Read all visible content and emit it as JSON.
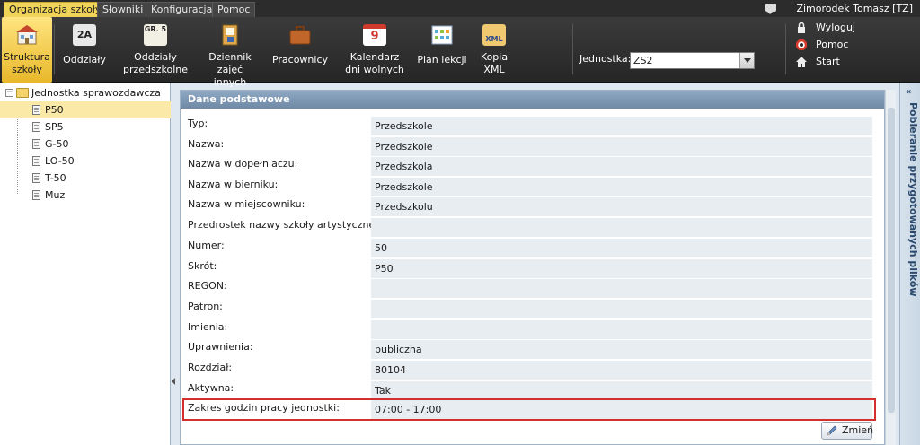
{
  "tabs": [
    "Organizacja szkoły",
    "Słowniki",
    "Konfiguracja",
    "Pomoc"
  ],
  "user": "Zimorodek Tomasz [TZ]",
  "toolbar": {
    "items": [
      {
        "label": "Struktura szkoły",
        "icon": "school-structure-icon"
      },
      {
        "label": "Oddziały",
        "icon": "class-2a-icon",
        "badge": "2A"
      },
      {
        "label": "Oddziały przedszkolne",
        "icon": "preschool-class-icon",
        "badge": "GR. 5"
      },
      {
        "label": "Dziennik zajęć innych",
        "icon": "journal-icon"
      },
      {
        "label": "Pracownicy",
        "icon": "briefcase-icon"
      },
      {
        "label": "Kalendarz dni wolnych",
        "icon": "calendar-icon",
        "badge": "9"
      },
      {
        "label": "Plan lekcji",
        "icon": "timetable-icon"
      },
      {
        "label": "Kopia XML",
        "icon": "xml-icon",
        "badge": "XML"
      }
    ],
    "unit_label": "Jednostka:",
    "unit_value": "ZS2",
    "links": [
      "Wyloguj",
      "Pomoc",
      "Start"
    ]
  },
  "tree": {
    "root": "Jednostka sprawozdawcza",
    "items": [
      "P50",
      "SP5",
      "G-50",
      "LO-50",
      "T-50",
      "Muz"
    ],
    "selected": "P50"
  },
  "panel": {
    "title": "Dane podstawowe",
    "fields": [
      {
        "label": "Typ:",
        "value": "Przedszkole"
      },
      {
        "label": "Nazwa:",
        "value": "Przedszkole"
      },
      {
        "label": "Nazwa w dopełniaczu:",
        "value": "Przedszkola"
      },
      {
        "label": "Nazwa w bierniku:",
        "value": "Przedszkole"
      },
      {
        "label": "Nazwa w miejscowniku:",
        "value": "Przedszkolu"
      },
      {
        "label": "Przedrostek nazwy szkoły artystycznej:",
        "value": ""
      },
      {
        "label": "Numer:",
        "value": "50"
      },
      {
        "label": "Skrót:",
        "value": "P50"
      },
      {
        "label": "REGON:",
        "value": ""
      },
      {
        "label": "Patron:",
        "value": ""
      },
      {
        "label": "Imienia:",
        "value": ""
      },
      {
        "label": "Uprawnienia:",
        "value": "publiczna"
      },
      {
        "label": "Rozdział:",
        "value": "80104"
      },
      {
        "label": "Aktywna:",
        "value": "Tak"
      },
      {
        "label": "Zakres godzin pracy jednostki:",
        "value": "07:00 - 17:00"
      }
    ],
    "change_button": "Zmień"
  },
  "right_panel": {
    "title": "Pobieranie przygotowanych plików"
  },
  "colors": {
    "accent": "#f0d45a",
    "highlight": "#d2302c",
    "header": "#7f98b5"
  }
}
